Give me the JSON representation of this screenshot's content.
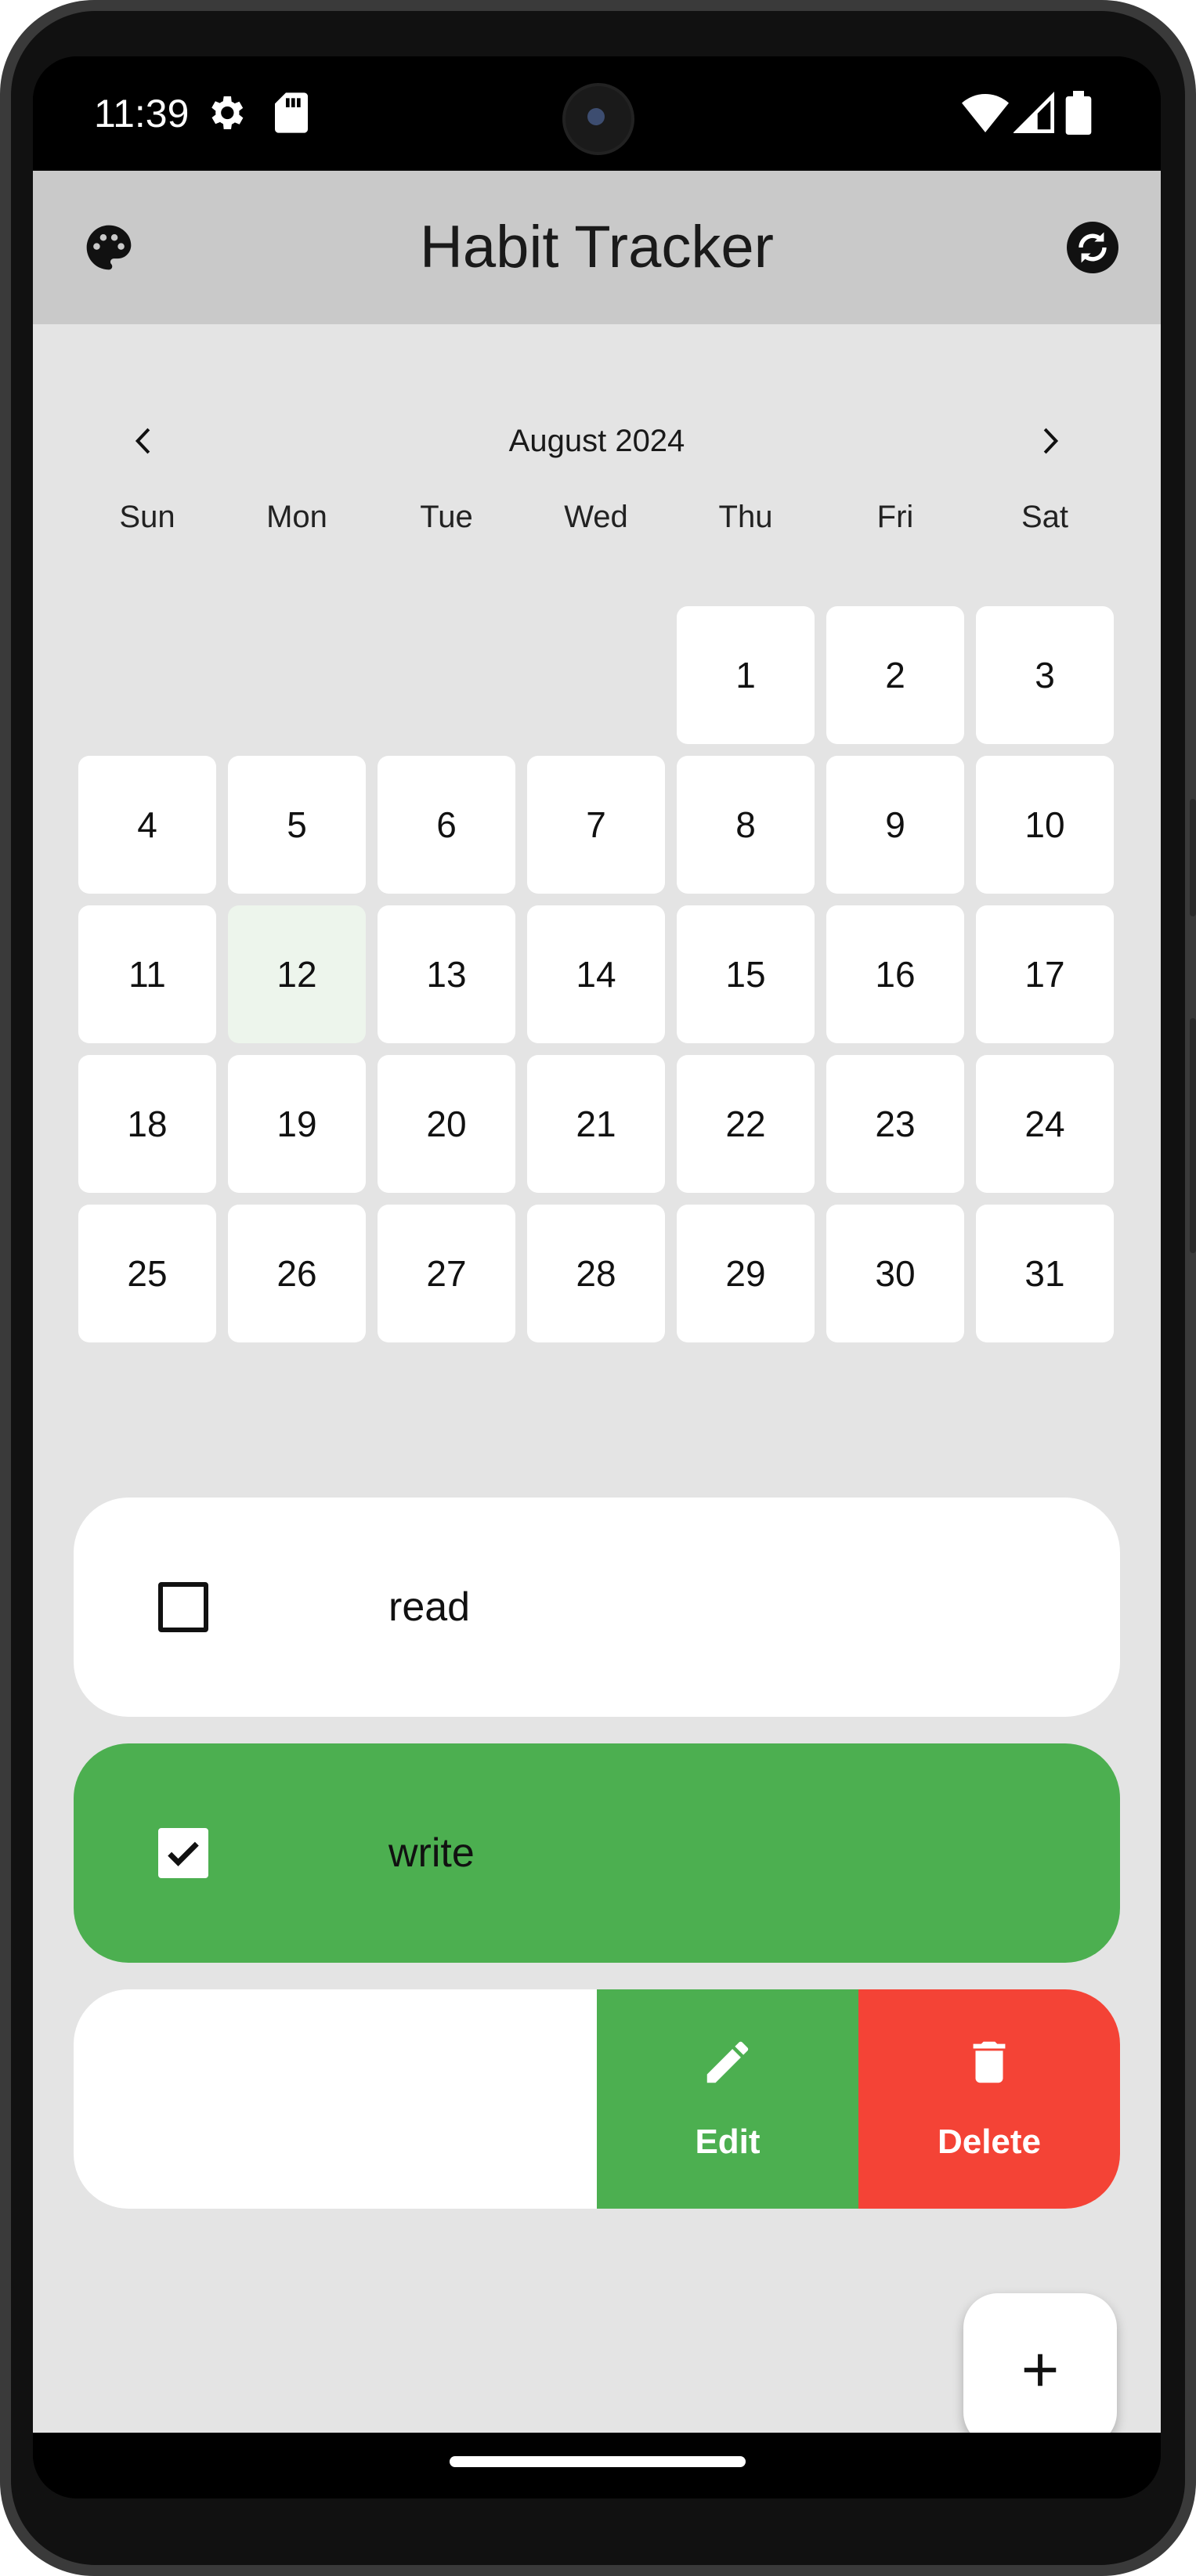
{
  "status_bar": {
    "time": "11:39",
    "icons": [
      "settings-gear-icon",
      "sd-card-icon",
      "wifi-icon",
      "cell-signal-icon",
      "battery-icon"
    ]
  },
  "app_bar": {
    "title": "Habit Tracker",
    "left_icon": "palette-icon",
    "right_icon": "sync-icon"
  },
  "calendar": {
    "month_label": "August 2024",
    "weekdays": [
      "Sun",
      "Mon",
      "Tue",
      "Wed",
      "Thu",
      "Fri",
      "Sat"
    ],
    "first_weekday_index": 4,
    "days": [
      "1",
      "2",
      "3",
      "4",
      "5",
      "6",
      "7",
      "8",
      "9",
      "10",
      "11",
      "12",
      "13",
      "14",
      "15",
      "16",
      "17",
      "18",
      "19",
      "20",
      "21",
      "22",
      "23",
      "24",
      "25",
      "26",
      "27",
      "28",
      "29",
      "30",
      "31"
    ],
    "highlighted_day": "12",
    "colors": {
      "cell": "#ffffff",
      "highlighted": "#edf5ec"
    }
  },
  "habits": [
    {
      "name": "read",
      "completed": false
    },
    {
      "name": "write",
      "completed": true
    }
  ],
  "swipe_actions": {
    "edit_label": "Edit",
    "delete_label": "Delete",
    "edit_icon": "pencil-icon",
    "delete_icon": "trash-icon"
  },
  "fab": {
    "icon": "plus-icon"
  },
  "colors": {
    "app_bar": "#c9c9c9",
    "background": "#e4e4e4",
    "completed": "#4caf50",
    "delete": "#f44336"
  }
}
